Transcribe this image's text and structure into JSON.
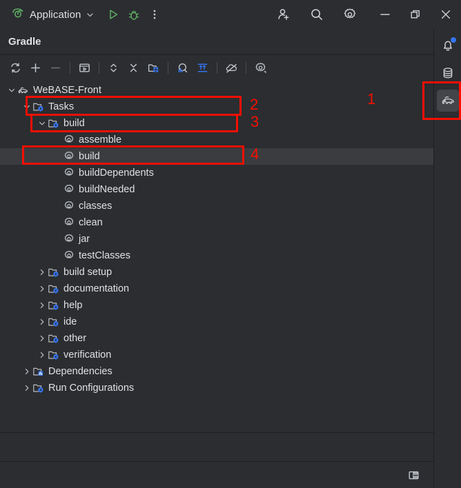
{
  "titlebar": {
    "run_config_name": "Application",
    "run_config_icon": "spring-boot-leaf-icon",
    "dropdown_icon": "chevron-down-icon",
    "buttons": [
      {
        "name": "run-button",
        "icon": "play-triangle-icon",
        "label": "Run"
      },
      {
        "name": "debug-button",
        "icon": "bug-icon",
        "label": "Debug"
      },
      {
        "name": "more-actions-button",
        "icon": "kebab-menu-icon",
        "label": "More Actions"
      },
      {
        "name": "code-with-me-button",
        "icon": "add-user-icon",
        "label": "Code With Me"
      },
      {
        "name": "search-everywhere-button",
        "icon": "search-icon",
        "label": "Search Everywhere"
      },
      {
        "name": "settings-button",
        "icon": "gear-icon",
        "label": "Settings"
      }
    ],
    "window_controls": [
      {
        "name": "minimize-button",
        "icon": "minimize-icon",
        "label": "Minimize"
      },
      {
        "name": "restore-button",
        "icon": "restore-window-icon",
        "label": "Restore Down"
      },
      {
        "name": "close-button",
        "icon": "close-icon",
        "label": "Close"
      }
    ]
  },
  "right_stripe": {
    "buttons": [
      {
        "name": "notifications-button",
        "icon": "bell-icon",
        "label": "Notifications",
        "badge": true,
        "active": false
      },
      {
        "name": "database-button",
        "icon": "database-icon",
        "label": "Database",
        "badge": false,
        "active": false
      },
      {
        "name": "gradle-button",
        "icon": "gradle-elephant-icon",
        "label": "Gradle",
        "badge": false,
        "active": true
      }
    ]
  },
  "toolwindow": {
    "title": "Gradle",
    "toolbar": [
      {
        "name": "reload-all-gradle-projects-button",
        "icon": "refresh-icon",
        "label": "Reload All Gradle Projects"
      },
      {
        "name": "link-gradle-project-button",
        "icon": "plus-icon",
        "label": "Link Gradle Project"
      },
      {
        "name": "unlink-gradle-project-button",
        "icon": "minus-icon",
        "label": "Unlink Gradle Project"
      },
      {
        "name": "run-configuration-button",
        "icon": "run-configuration-icon",
        "label": "Run Configuration"
      },
      {
        "name": "expand-all-button",
        "icon": "expand-collapse-icon",
        "label": "Expand All"
      },
      {
        "name": "collapse-all-button",
        "icon": "collapse-all-icon",
        "label": "Collapse All"
      },
      {
        "name": "toggle-tasks-grouping-button",
        "icon": "folder-grid-icon",
        "label": "Group Tasks"
      },
      {
        "name": "analyze-dependencies-button",
        "icon": "magnifier-bars-icon",
        "label": "Analyze Dependencies"
      },
      {
        "name": "align-button",
        "icon": "align-arrows-icon",
        "label": "Show Task Names"
      },
      {
        "name": "toggle-offline-mode-button",
        "icon": "cloud-off-icon",
        "label": "Toggle Offline Mode"
      },
      {
        "name": "gradle-settings-button",
        "icon": "gear-dropdown-icon",
        "label": "Gradle Settings"
      }
    ],
    "tree": [
      {
        "label": "WeBASE-Front",
        "icon": "gradle-elephant-icon",
        "indent": 0,
        "twisty": "expanded",
        "selected": false
      },
      {
        "label": "Tasks",
        "icon": "folder-gradle-icon",
        "indent": 1,
        "twisty": "expanded",
        "selected": false
      },
      {
        "label": "build",
        "icon": "folder-gradle-icon",
        "indent": 2,
        "twisty": "expanded",
        "selected": false
      },
      {
        "label": "assemble",
        "icon": "gradle-task-gear-icon",
        "indent": 3,
        "twisty": "none",
        "selected": false
      },
      {
        "label": "build",
        "icon": "gradle-task-gear-icon",
        "indent": 3,
        "twisty": "none",
        "selected": true
      },
      {
        "label": "buildDependents",
        "icon": "gradle-task-gear-icon",
        "indent": 3,
        "twisty": "none",
        "selected": false
      },
      {
        "label": "buildNeeded",
        "icon": "gradle-task-gear-icon",
        "indent": 3,
        "twisty": "none",
        "selected": false
      },
      {
        "label": "classes",
        "icon": "gradle-task-gear-icon",
        "indent": 3,
        "twisty": "none",
        "selected": false
      },
      {
        "label": "clean",
        "icon": "gradle-task-gear-icon",
        "indent": 3,
        "twisty": "none",
        "selected": false
      },
      {
        "label": "jar",
        "icon": "gradle-task-gear-icon",
        "indent": 3,
        "twisty": "none",
        "selected": false
      },
      {
        "label": "testClasses",
        "icon": "gradle-task-gear-icon",
        "indent": 3,
        "twisty": "none",
        "selected": false
      },
      {
        "label": "build setup",
        "icon": "folder-gradle-icon",
        "indent": 2,
        "twisty": "collapsed",
        "selected": false
      },
      {
        "label": "documentation",
        "icon": "folder-gradle-icon",
        "indent": 2,
        "twisty": "collapsed",
        "selected": false
      },
      {
        "label": "help",
        "icon": "folder-gradle-icon",
        "indent": 2,
        "twisty": "collapsed",
        "selected": false
      },
      {
        "label": "ide",
        "icon": "folder-gradle-icon",
        "indent": 2,
        "twisty": "collapsed",
        "selected": false
      },
      {
        "label": "other",
        "icon": "folder-gradle-icon",
        "indent": 2,
        "twisty": "collapsed",
        "selected": false
      },
      {
        "label": "verification",
        "icon": "folder-gradle-icon",
        "indent": 2,
        "twisty": "collapsed",
        "selected": false
      },
      {
        "label": "Dependencies",
        "icon": "folder-dependencies-icon",
        "indent": 1,
        "twisty": "collapsed",
        "selected": false
      },
      {
        "label": "Run Configurations",
        "icon": "folder-gradle-icon",
        "indent": 1,
        "twisty": "collapsed",
        "selected": false
      }
    ],
    "statusbar": {
      "layout_button": {
        "name": "layout-button",
        "icon": "split-layout-icon",
        "label": "Layout"
      }
    }
  },
  "annotations": {
    "color": "#fa0f00",
    "items": [
      {
        "number": "1",
        "target": "gradle-stripe-button"
      },
      {
        "number": "2",
        "target": "tasks-tree-row"
      },
      {
        "number": "3",
        "target": "build-group-tree-row"
      },
      {
        "number": "4",
        "target": "build-task-tree-row"
      }
    ]
  }
}
